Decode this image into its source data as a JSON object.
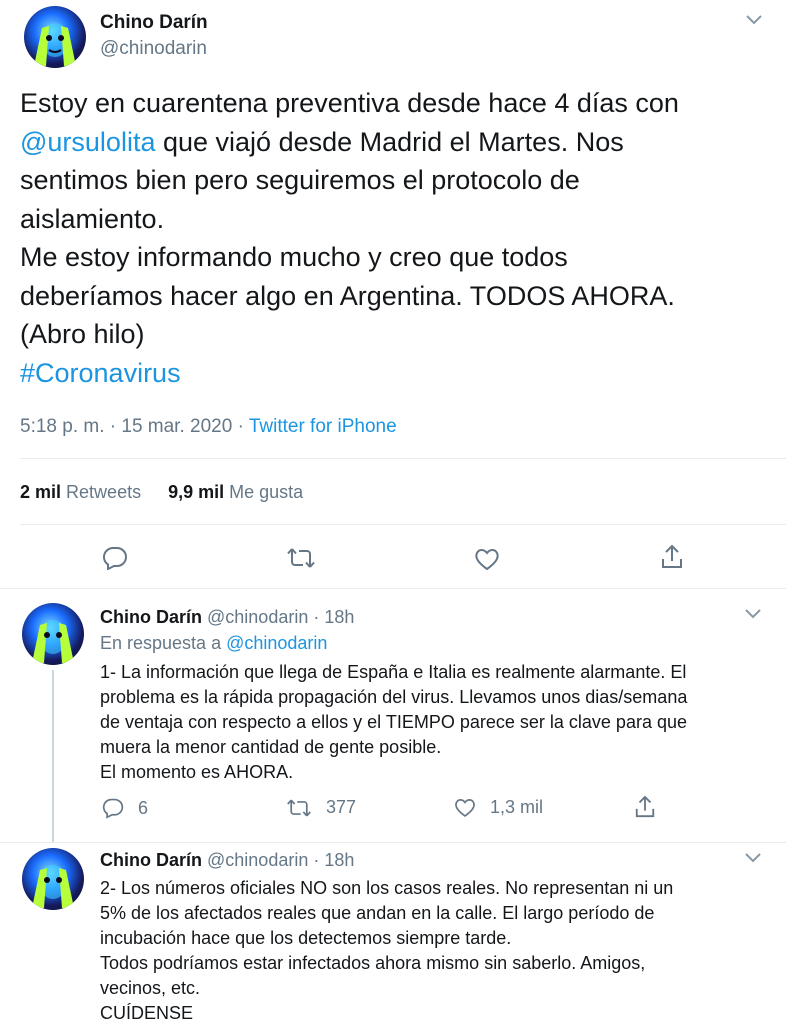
{
  "main_tweet": {
    "author_name": "Chino Darín",
    "handle": "@chinodarin",
    "text_1": "Estoy en cuarentena preventiva desde hace 4 días con",
    "mention": "@ursulolita",
    "text_2": "que viajó desde Madrid el Martes. Nos",
    "text_3": "sentimos bien pero seguiremos el protocolo de",
    "text_4": "aislamiento.",
    "text_5": "Me estoy informando mucho y creo que todos",
    "text_6": "deberíamos hacer algo en Argentina. TODOS AHORA.",
    "text_7": "(Abro hilo)",
    "hashtag": "#Coronavirus",
    "timestamp": "5:18 p. m. · 15 mar. 2020 ·",
    "source": "Twitter for iPhone",
    "retweets_count": "2 mil",
    "retweets_label": "Retweets",
    "likes_count": "9,9 mil",
    "likes_label": "Me gusta"
  },
  "reply_1": {
    "author_name": "Chino Darín",
    "handle_time": "@chinodarin · 18h",
    "in_reply_prefix": "En respuesta a",
    "in_reply_handle": "@chinodarin",
    "lines": [
      "1- La información que llega de España e Italia es realmente alarmante. El",
      "problema es la rápida propagación del virus. Llevamos unos dias/semana",
      "de ventaja con respecto a ellos y el TIEMPO parece ser la clave para que",
      "muera la menor cantidad de gente posible.",
      "El momento es AHORA."
    ],
    "replies": "6",
    "retweets": "377",
    "likes": "1,3 mil"
  },
  "reply_2": {
    "author_name": "Chino Darín",
    "handle_time": "@chinodarin · 18h",
    "lines": [
      "2- Los números oficiales NO son los casos reales. No representan ni un",
      "5% de los afectados reales que andan en la calle. El largo período de",
      "incubación hace que los detectemos siempre tarde.",
      "Todos podríamos estar infectados ahora mismo sin saberlo. Amigos,",
      "vecinos, etc.",
      "CUÍDENSE"
    ]
  },
  "icons": [
    "chevron-down-icon",
    "reply-icon",
    "retweet-icon",
    "like-icon",
    "share-icon"
  ],
  "colors": {
    "link": "#1b95e0",
    "muted": "#657786",
    "text": "#14171a",
    "divider": "#e6ecf0"
  }
}
